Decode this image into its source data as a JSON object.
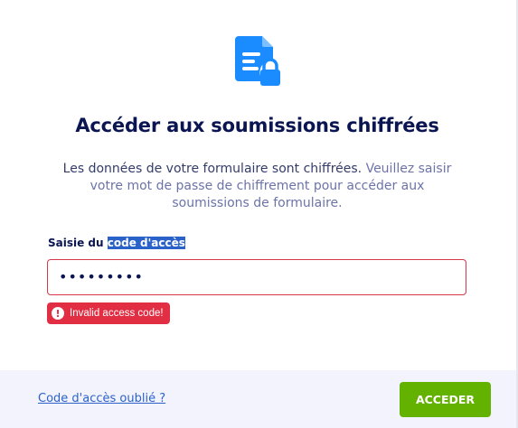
{
  "dialog": {
    "icon": "encrypted-document-lock-icon",
    "title": "Accéder aux soumissions chiffrées",
    "description_part1": "Les données de votre formulaire sont chiffrées.",
    "description_part2": " Veuillez saisir votre mot de passe de chiffrement pour accéder aux soumissions de formulaire."
  },
  "form": {
    "label_prefix": "Saisie du ",
    "label_highlight": "code d'accès",
    "password_value": "•••••••••",
    "error_icon": "exclamation-icon",
    "error_message": "Invalid access code!"
  },
  "footer": {
    "forgot_link": "Code d'accès oublié ?",
    "submit_label": "ACCEDER"
  },
  "colors": {
    "accent_blue": "#2a62c9",
    "icon_blue": "#1a8cff",
    "error_red": "#e22e43",
    "submit_green": "#64b200",
    "title_navy": "#0a1551"
  }
}
